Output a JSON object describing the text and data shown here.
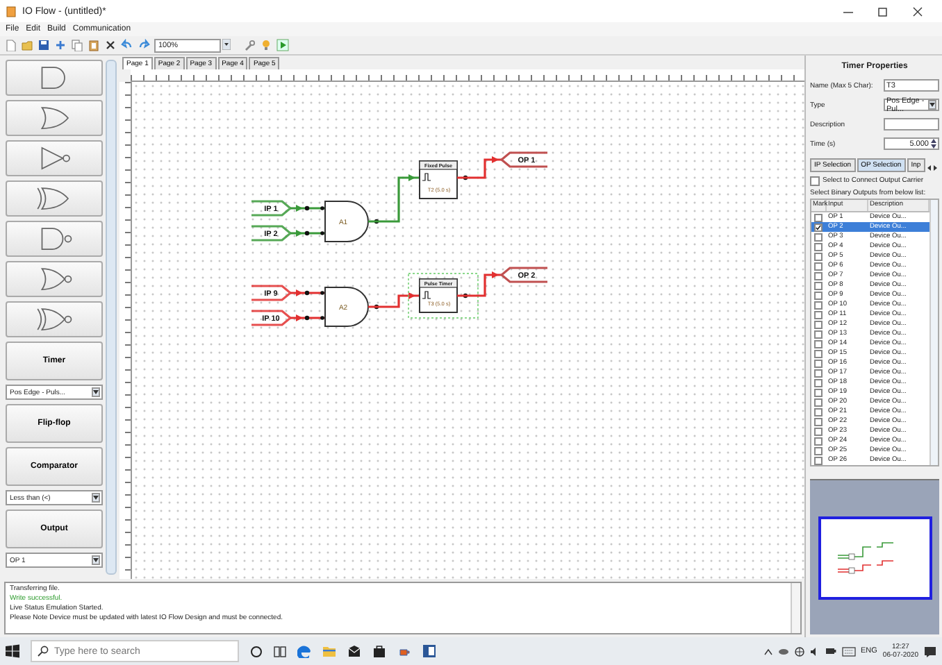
{
  "window": {
    "title": "IO Flow - (untitled)*"
  },
  "menu": [
    "File",
    "Edit",
    "Build",
    "Communication"
  ],
  "toolbar": {
    "zoom": "100%"
  },
  "palette": [
    {
      "kind": "and"
    },
    {
      "kind": "or"
    },
    {
      "kind": "not"
    },
    {
      "kind": "xor"
    },
    {
      "kind": "nand"
    },
    {
      "kind": "nor"
    },
    {
      "kind": "xnor"
    },
    {
      "kind": "button",
      "label": "Timer"
    },
    {
      "kind": "select",
      "value": "Pos Edge - Puls..."
    },
    {
      "kind": "button",
      "label": "Flip-flop"
    },
    {
      "kind": "button",
      "label": "Comparator"
    },
    {
      "kind": "select",
      "value": "Less than (<)"
    },
    {
      "kind": "button",
      "label": "Output"
    },
    {
      "kind": "select",
      "value": "OP 1"
    }
  ],
  "page_tabs": [
    {
      "label": "Page 1",
      "selected": true
    },
    {
      "label": "Page 2",
      "selected": false
    },
    {
      "label": "Page 3",
      "selected": false
    },
    {
      "label": "Page 4",
      "selected": false
    },
    {
      "label": "Page 5",
      "selected": false
    }
  ],
  "diagram": {
    "circuits": [
      {
        "inputs": [
          {
            "label": "IP 1",
            "active": true
          },
          {
            "label": "IP 2",
            "active": true
          }
        ],
        "gate": "A1",
        "gate_output_active": true,
        "timer": {
          "title": "Fixed Pulse",
          "label": "T2 (5.0 s)",
          "selected": false
        },
        "timer_output_active": false,
        "output": "OP 1"
      },
      {
        "inputs": [
          {
            "label": "IP 9",
            "active": false
          },
          {
            "label": "IP 10",
            "active": false
          }
        ],
        "gate": "A2",
        "gate_output_active": false,
        "timer": {
          "title": "Pulse Timer",
          "label": "T3 (5.0 s)",
          "selected": true
        },
        "timer_output_active": false,
        "output": "OP 2"
      }
    ]
  },
  "properties": {
    "title": "Timer Properties",
    "fields": [
      {
        "label": "Name (Max 5 Char):",
        "kind": "text",
        "value": "T3"
      },
      {
        "label": "Type",
        "kind": "select",
        "value": "Pos Edge - Pul..."
      },
      {
        "label": "Description",
        "kind": "text"
      },
      {
        "label": "Time (s)",
        "kind": "spinner",
        "value": "5.000"
      }
    ],
    "tabs": [
      {
        "label": "IP Selection",
        "selected": false
      },
      {
        "label": "OP Selection",
        "selected": true
      },
      {
        "label": "Inp",
        "selected": false
      }
    ],
    "carrier": {
      "label": "Select to Connect Output Carrier",
      "checked": false
    },
    "list_label": "Select Binary Outputs from below list:",
    "columns": [
      "Mark",
      "Input",
      "Description"
    ],
    "rows": [
      {
        "input": "OP 1",
        "description": "Device Ou...",
        "checked": false,
        "selected": false
      },
      {
        "input": "OP 2",
        "description": "Device Ou...",
        "checked": true,
        "selected": true
      },
      {
        "input": "OP 3",
        "description": "Device Ou...",
        "checked": false,
        "selected": false
      },
      {
        "input": "OP 4",
        "description": "Device Ou...",
        "checked": false,
        "selected": false
      },
      {
        "input": "OP 5",
        "description": "Device Ou...",
        "checked": false,
        "selected": false
      },
      {
        "input": "OP 6",
        "description": "Device Ou...",
        "checked": false,
        "selected": false
      },
      {
        "input": "OP 7",
        "description": "Device Ou...",
        "checked": false,
        "selected": false
      },
      {
        "input": "OP 8",
        "description": "Device Ou...",
        "checked": false,
        "selected": false
      },
      {
        "input": "OP 9",
        "description": "Device Ou...",
        "checked": false,
        "selected": false
      },
      {
        "input": "OP 10",
        "description": "Device Ou...",
        "checked": false,
        "selected": false
      },
      {
        "input": "OP 11",
        "description": "Device Ou...",
        "checked": false,
        "selected": false
      },
      {
        "input": "OP 12",
        "description": "Device Ou...",
        "checked": false,
        "selected": false
      },
      {
        "input": "OP 13",
        "description": "Device Ou...",
        "checked": false,
        "selected": false
      },
      {
        "input": "OP 14",
        "description": "Device Ou...",
        "checked": false,
        "selected": false
      },
      {
        "input": "OP 15",
        "description": "Device Ou...",
        "checked": false,
        "selected": false
      },
      {
        "input": "OP 16",
        "description": "Device Ou...",
        "checked": false,
        "selected": false
      },
      {
        "input": "OP 17",
        "description": "Device Ou...",
        "checked": false,
        "selected": false
      },
      {
        "input": "OP 18",
        "description": "Device Ou...",
        "checked": false,
        "selected": false
      },
      {
        "input": "OP 19",
        "description": "Device Ou...",
        "checked": false,
        "selected": false
      },
      {
        "input": "OP 20",
        "description": "Device Ou...",
        "checked": false,
        "selected": false
      },
      {
        "input": "OP 21",
        "description": "Device Ou...",
        "checked": false,
        "selected": false
      },
      {
        "input": "OP 22",
        "description": "Device Ou...",
        "checked": false,
        "selected": false
      },
      {
        "input": "OP 23",
        "description": "Device Ou...",
        "checked": false,
        "selected": false
      },
      {
        "input": "OP 24",
        "description": "Device Ou...",
        "checked": false,
        "selected": false
      },
      {
        "input": "OP 25",
        "description": "Device Ou...",
        "checked": false,
        "selected": false
      },
      {
        "input": "OP 26",
        "description": "Device Ou...",
        "checked": false,
        "selected": false
      }
    ]
  },
  "log": [
    {
      "text": "Transferring file.",
      "kind": "info"
    },
    {
      "text": "Write successful.",
      "kind": "success"
    },
    {
      "text": "Live Status Emulation Started.",
      "kind": "info"
    },
    {
      "text": "Please Note Device must be updated with latest IO Flow Design and must be connected.",
      "kind": "info"
    }
  ],
  "taskbar": {
    "search_placeholder": "Type here to search",
    "language": "ENG",
    "time": "12:27",
    "date": "06-07-2020"
  }
}
